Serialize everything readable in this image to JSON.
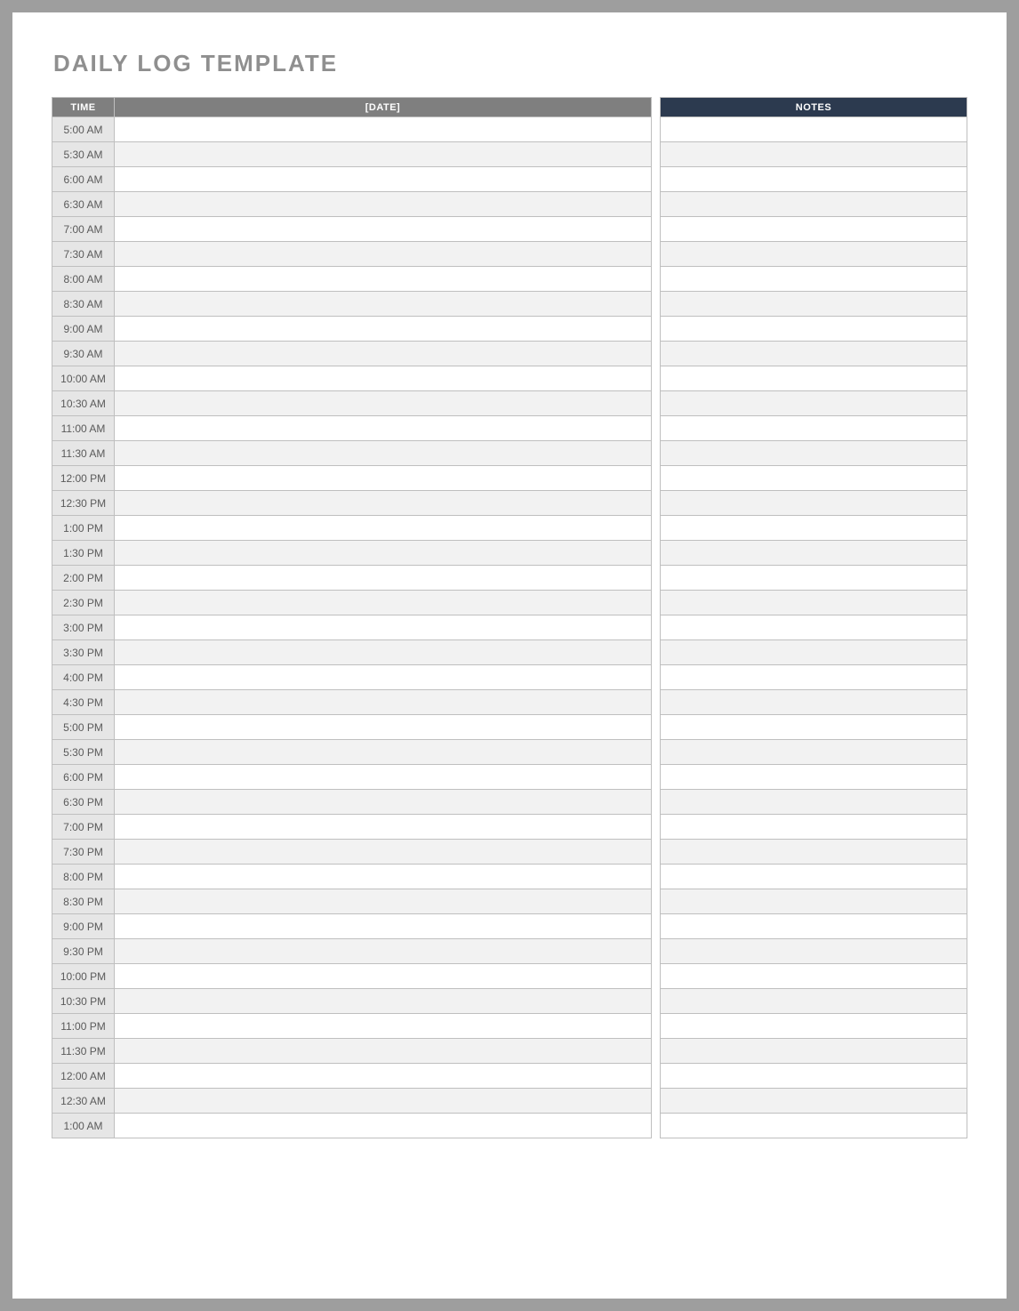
{
  "title": "DAILY LOG TEMPLATE",
  "headers": {
    "time": "TIME",
    "date": "[DATE]",
    "notes": "NOTES"
  },
  "rows": [
    {
      "time": "5:00 AM",
      "entry": "",
      "notes": ""
    },
    {
      "time": "5:30 AM",
      "entry": "",
      "notes": ""
    },
    {
      "time": "6:00 AM",
      "entry": "",
      "notes": ""
    },
    {
      "time": "6:30 AM",
      "entry": "",
      "notes": ""
    },
    {
      "time": "7:00 AM",
      "entry": "",
      "notes": ""
    },
    {
      "time": "7:30 AM",
      "entry": "",
      "notes": ""
    },
    {
      "time": "8:00 AM",
      "entry": "",
      "notes": ""
    },
    {
      "time": "8:30 AM",
      "entry": "",
      "notes": ""
    },
    {
      "time": "9:00 AM",
      "entry": "",
      "notes": ""
    },
    {
      "time": "9:30 AM",
      "entry": "",
      "notes": ""
    },
    {
      "time": "10:00 AM",
      "entry": "",
      "notes": ""
    },
    {
      "time": "10:30 AM",
      "entry": "",
      "notes": ""
    },
    {
      "time": "11:00 AM",
      "entry": "",
      "notes": ""
    },
    {
      "time": "11:30 AM",
      "entry": "",
      "notes": ""
    },
    {
      "time": "12:00 PM",
      "entry": "",
      "notes": ""
    },
    {
      "time": "12:30 PM",
      "entry": "",
      "notes": ""
    },
    {
      "time": "1:00 PM",
      "entry": "",
      "notes": ""
    },
    {
      "time": "1:30 PM",
      "entry": "",
      "notes": ""
    },
    {
      "time": "2:00 PM",
      "entry": "",
      "notes": ""
    },
    {
      "time": "2:30 PM",
      "entry": "",
      "notes": ""
    },
    {
      "time": "3:00 PM",
      "entry": "",
      "notes": ""
    },
    {
      "time": "3:30 PM",
      "entry": "",
      "notes": ""
    },
    {
      "time": "4:00 PM",
      "entry": "",
      "notes": ""
    },
    {
      "time": "4:30 PM",
      "entry": "",
      "notes": ""
    },
    {
      "time": "5:00 PM",
      "entry": "",
      "notes": ""
    },
    {
      "time": "5:30 PM",
      "entry": "",
      "notes": ""
    },
    {
      "time": "6:00 PM",
      "entry": "",
      "notes": ""
    },
    {
      "time": "6:30 PM",
      "entry": "",
      "notes": ""
    },
    {
      "time": "7:00 PM",
      "entry": "",
      "notes": ""
    },
    {
      "time": "7:30 PM",
      "entry": "",
      "notes": ""
    },
    {
      "time": "8:00 PM",
      "entry": "",
      "notes": ""
    },
    {
      "time": "8:30 PM",
      "entry": "",
      "notes": ""
    },
    {
      "time": "9:00 PM",
      "entry": "",
      "notes": ""
    },
    {
      "time": "9:30 PM",
      "entry": "",
      "notes": ""
    },
    {
      "time": "10:00 PM",
      "entry": "",
      "notes": ""
    },
    {
      "time": "10:30 PM",
      "entry": "",
      "notes": ""
    },
    {
      "time": "11:00 PM",
      "entry": "",
      "notes": ""
    },
    {
      "time": "11:30 PM",
      "entry": "",
      "notes": ""
    },
    {
      "time": "12:00 AM",
      "entry": "",
      "notes": ""
    },
    {
      "time": "12:30 AM",
      "entry": "",
      "notes": ""
    },
    {
      "time": "1:00 AM",
      "entry": "",
      "notes": ""
    }
  ]
}
